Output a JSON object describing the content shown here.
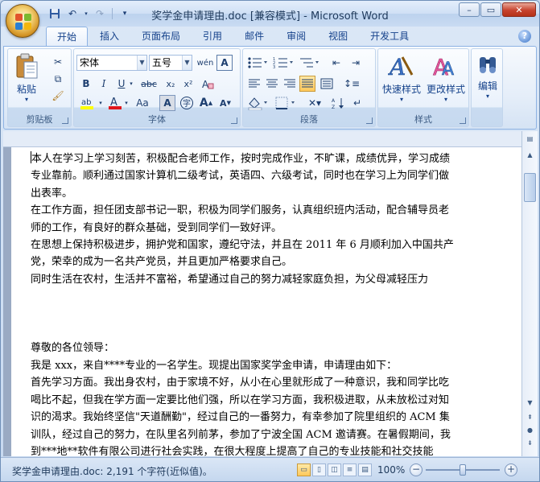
{
  "window": {
    "title": "奖学金申请理由.doc [兼容模式] - Microsoft Word",
    "controls": [
      "–",
      "▭",
      "✕"
    ]
  },
  "quick_access": {
    "save_icon": "save-icon",
    "undo_icon": "undo-icon",
    "redo_icon": "redo-icon"
  },
  "tabs": [
    "开始",
    "插入",
    "页面布局",
    "引用",
    "邮件",
    "审阅",
    "视图",
    "开发工具"
  ],
  "ribbon": {
    "clipboard": {
      "label": "剪贴板",
      "paste": "粘贴"
    },
    "font": {
      "label": "字体",
      "font_name": "宋体",
      "font_size": "五号",
      "bold": "B",
      "italic": "I",
      "underline": "U",
      "strike": "abc",
      "subscript": "x₂",
      "superscript": "x²",
      "case": "Aa",
      "grow": "A",
      "shrink": "A"
    },
    "paragraph": {
      "label": "段落"
    },
    "styles": {
      "label": "样式",
      "quick_styles": "快速样式",
      "change_styles": "更改样式"
    },
    "editing": {
      "label": "编辑"
    }
  },
  "document": {
    "paragraphs": [
      "本人在学习上学习刻苦，积极配合老师工作，按时完成作业，不旷课，成绩优异，学习成绩",
      "专业靠前。顺利通过国家计算机二级考试，英语四、六级考试，同时也在学习上为同学们做",
      "出表率。",
      "在工作方面，担任团支部书记一职，积极为同学们服务，认真组织班内活动，配合辅导员老",
      "师的工作，有良好的群众基础，受到同学们一致好评。",
      "在思想上保持积极进步，拥护党和国家，遵纪守法，并且在 2011 年 6 月顺利加入中国共产",
      "党，荣幸的成为一名共产党员，并且更加严格要求自己。",
      "同时生活在农村，生活并不富裕，希望通过自己的努力减轻家庭负担，为父母减轻压力",
      "",
      "",
      "",
      "尊敬的各位领导：",
      "我是 xxx，来自****专业的一名学生。现提出国家奖学金申请，申请理由如下：",
      "首先学习方面。我出身农村，由于家境不好，从小在心里就形成了一种意识，我和同学比吃",
      "喝比不起，但我在学方面一定要比他们强，所以在学习方面，我积极进取，从未放松过对知",
      "识的渴求。我始终坚信\"天道酬勤\"，经过自己的一番努力，有幸参加了院里组织的 ACM 集",
      "训队，经过自己的努力，在队里名列前茅，参加了宁波全国 ACM 邀请赛。在暑假期间，我",
      "到***地**软件有限公司进行社会实践，在很大程度上提高了自己的专业技能和社交技能"
    ]
  },
  "status": {
    "text": "奖学金申请理由.doc: 2,191 个字符(近似值)。",
    "zoom": "100%",
    "zoom_level_percent": 100
  }
}
